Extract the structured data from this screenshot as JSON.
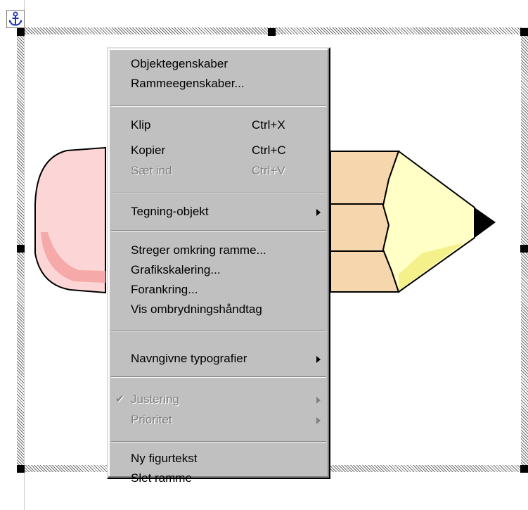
{
  "menu": {
    "items": [
      {
        "label": "Objektegenskaber"
      },
      {
        "label": "Rammeegenskaber..."
      },
      {
        "label": "Klip",
        "shortcut": "Ctrl+X"
      },
      {
        "label": "Kopier",
        "shortcut": "Ctrl+C"
      },
      {
        "label": "Sæt ind",
        "shortcut": "Ctrl+V"
      },
      {
        "label": "Tegning-objekt"
      },
      {
        "label": "Streger omkring ramme..."
      },
      {
        "label": "Grafikskalering..."
      },
      {
        "label": "Forankring..."
      },
      {
        "label": "Vis ombrydningshåndtag"
      },
      {
        "label": "Navngivne typografier"
      },
      {
        "label": "Justering",
        "check": "✔"
      },
      {
        "label": "Prioritet"
      },
      {
        "label": "Ny figurtekst"
      },
      {
        "label": "Slet ramme"
      }
    ],
    "disabled": [
      "Sæt ind",
      "Justering",
      "Prioritet"
    ]
  },
  "icons": {
    "anchor": "anchor-icon",
    "submenu": "submenu-arrow-icon",
    "check": "checkmark-icon"
  },
  "colors": {
    "menu_face": "#c0c0c0",
    "disabled_text": "#808080",
    "eraser": "#fcd5d5",
    "pencil_wood": "#f7d9b0",
    "pencil_tip": "#ffffc8",
    "lead": "#000000",
    "anchor": "#1a35b8"
  }
}
